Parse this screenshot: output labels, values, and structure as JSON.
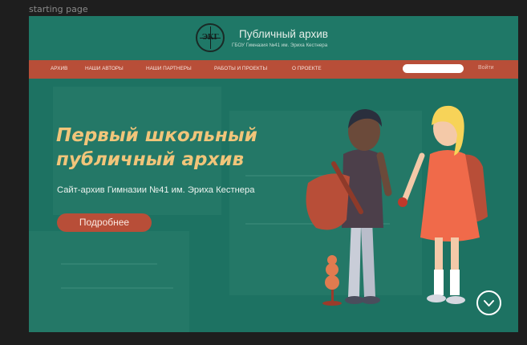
{
  "frame": {
    "label": "starting page"
  },
  "header": {
    "logo_letters": "ЭКГ",
    "title": "Публичный архив",
    "subtitle": "ГБОУ Гимназия №41 им. Эриха Кестнера"
  },
  "nav": {
    "items": [
      {
        "label": "АРХИВ"
      },
      {
        "label": "НАШИ АВТОРЫ"
      },
      {
        "label": "НАШИ ПАРТНЕРЫ"
      },
      {
        "label": "РАБОТЫ И ПРОЕКТЫ"
      },
      {
        "label": "О ПРОЕКТЕ"
      }
    ],
    "search_value": "",
    "login_label": "Войти"
  },
  "hero": {
    "heading_line1": "Первый школьный",
    "heading_line2": "публичный архив",
    "subheading": "Сайт-архив Гимназии №41 им. Эриха Кестнера",
    "button_label": "Подробнее"
  },
  "colors": {
    "brand_green": "#1d7262",
    "accent_terracotta": "#b84e38",
    "heading_yellow": "#f1c57a"
  },
  "icons": {
    "scroll": "chevron-down-icon"
  }
}
